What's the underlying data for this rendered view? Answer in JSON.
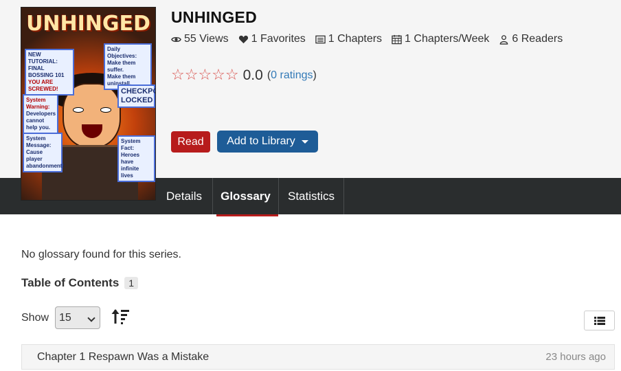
{
  "series": {
    "title": "UNHINGED",
    "cover": {
      "title": "UNHINGED",
      "panels": [
        "NEW TUTORIAL: FINAL BOSSING 101",
        "YOU ARE SCREWED!",
        "Daily Objectives:",
        "Make them suffer.",
        "Make them uninstall.",
        "CHECKPOINT LOCKED",
        "System Warning:",
        "Developers cannot help you.",
        "System Message:",
        "Cause player abandonment!",
        "System Fact:",
        "Heroes have infinite lives"
      ]
    },
    "stats": {
      "views": "55 Views",
      "favorites": "1 Favorites",
      "chapters": "1 Chapters",
      "chapters_per_week": "1 Chapters/Week",
      "readers": "6 Readers"
    },
    "rating": {
      "stars": "☆☆☆☆☆",
      "score": "0.0",
      "open_paren": "(",
      "ratings_link": "0 ratings",
      "close_paren": ")"
    },
    "buttons": {
      "read": "Read",
      "add_to_library": "Add to Library"
    }
  },
  "tabs": [
    {
      "label": "Details",
      "active": false
    },
    {
      "label": "Glossary",
      "active": true
    },
    {
      "label": "Statistics",
      "active": false
    }
  ],
  "glossary": {
    "empty_message": "No glossary found for this series."
  },
  "toc": {
    "heading": "Table of Contents",
    "count": "1",
    "show_label": "Show",
    "page_size": "15",
    "chapters": [
      {
        "title": "Chapter 1 Respawn Was a Mistake",
        "time": "23 hours ago"
      }
    ]
  },
  "colors": {
    "read_button": "#b71c1c",
    "library_button": "#1e5c97",
    "tabbar": "#2a2d2e",
    "star": "#d9534f",
    "link": "#337ab7"
  }
}
